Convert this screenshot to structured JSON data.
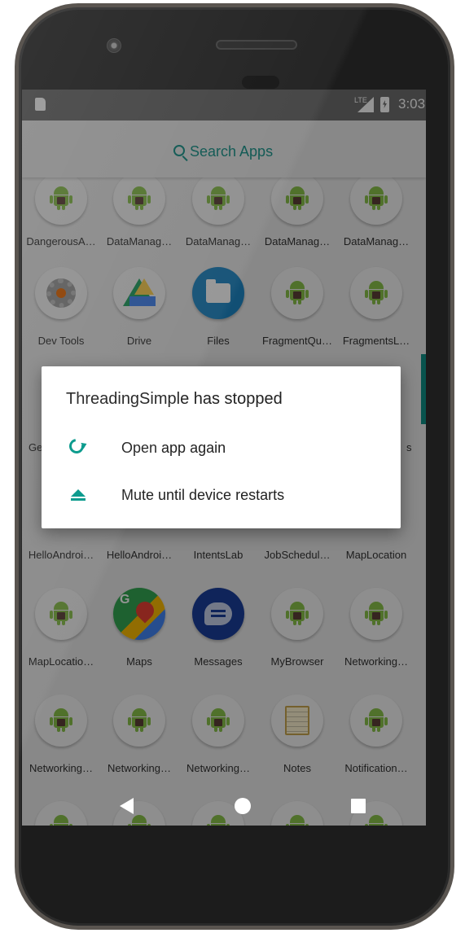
{
  "status_bar": {
    "network": "LTE",
    "time": "3:03"
  },
  "search": {
    "label": "Search Apps"
  },
  "apps": {
    "row1": [
      "DangerousA…",
      "DataManag…",
      "DataManag…",
      "DataManag…",
      "DataManag…"
    ],
    "row2": [
      "Dev Tools",
      "Drive",
      "Files",
      "FragmentQu…",
      "FragmentsL…"
    ],
    "row3_partial": [
      "Ge",
      "s"
    ],
    "row4": [
      "HelloAndroi…",
      "HelloAndroi…",
      "IntentsLab",
      "JobSchedul…",
      "MapLocation"
    ],
    "row5": [
      "MapLocatio…",
      "Maps",
      "Messages",
      "MyBrowser",
      "Networking…"
    ],
    "row6": [
      "Networking…",
      "Networking…",
      "Networking…",
      "Notes",
      "Notification…"
    ]
  },
  "dialog": {
    "title": "ThreadingSimple has stopped",
    "options": [
      {
        "label": "Open app again",
        "icon": "reload-icon"
      },
      {
        "label": "Mute until device restarts",
        "icon": "eject-icon"
      }
    ]
  },
  "colors": {
    "accent": "#009688",
    "search_accent": "#0e8f85",
    "android_green": "#8bc34a"
  }
}
